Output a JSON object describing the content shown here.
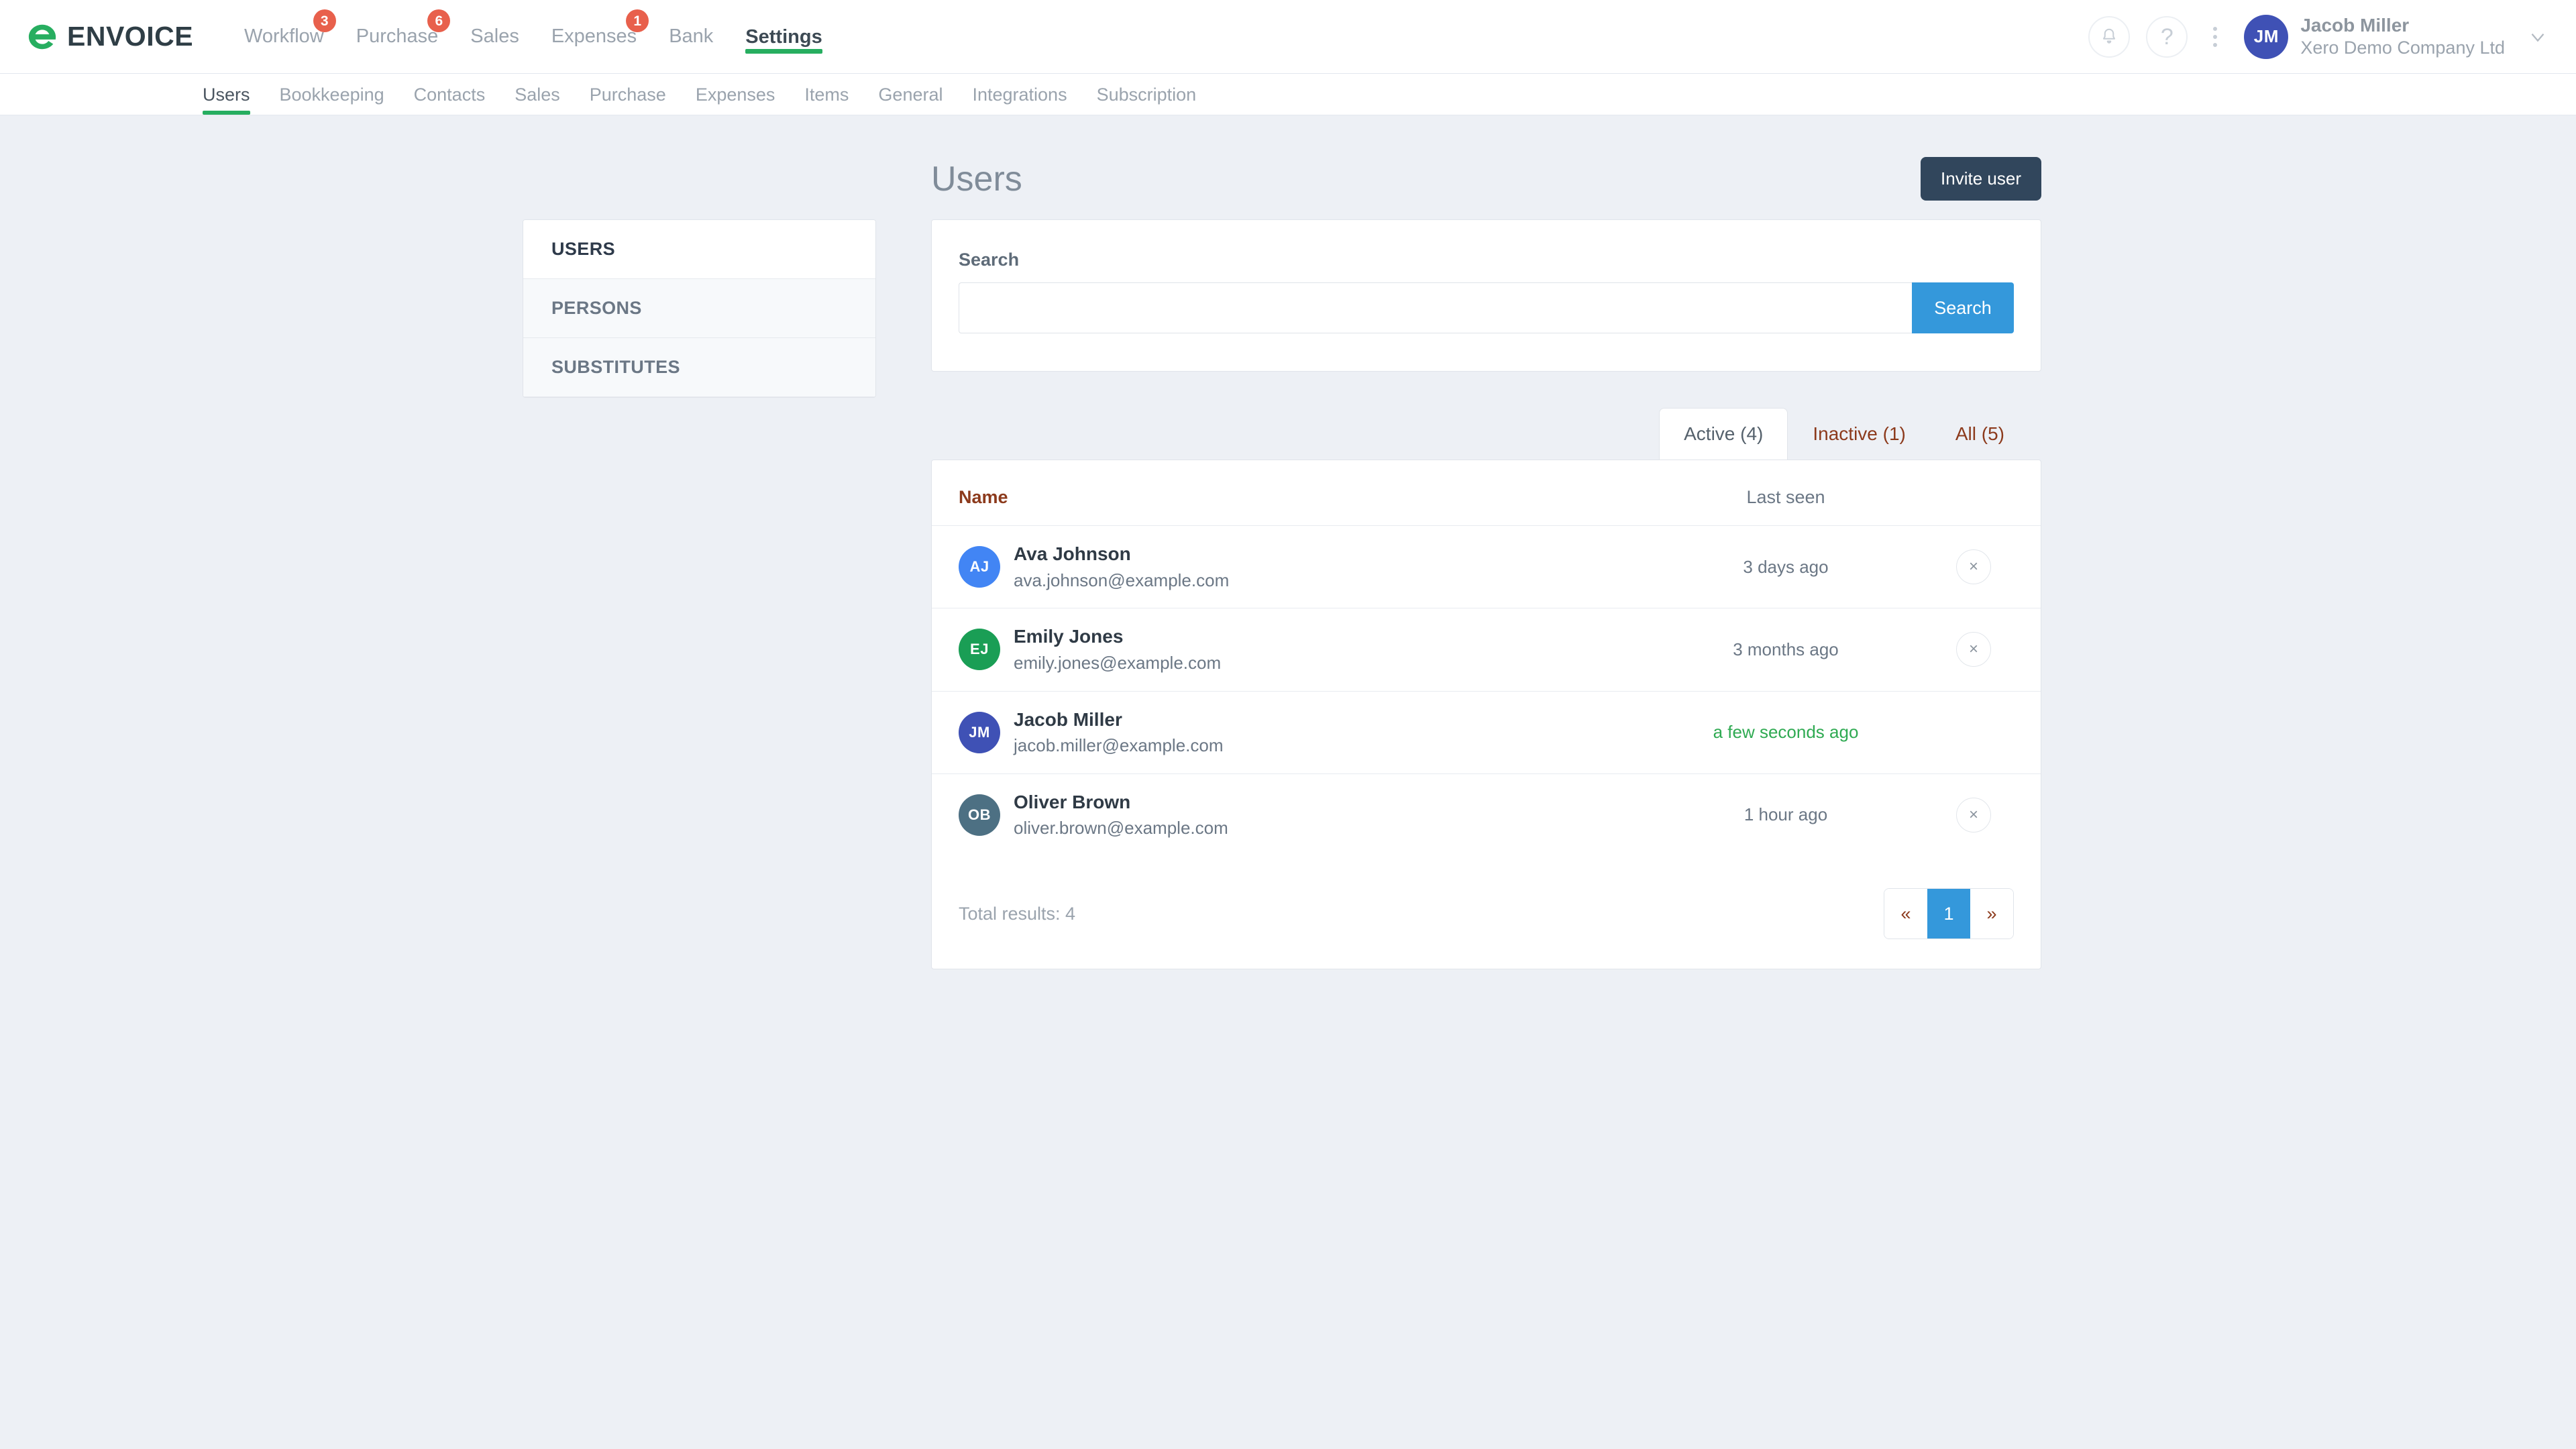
{
  "brand": {
    "name": "ENVOICE",
    "mark_color": "#27ae60",
    "text_color": "#2f3e46"
  },
  "topnav": {
    "items": [
      {
        "label": "Workflow",
        "badge": "3",
        "active": false
      },
      {
        "label": "Purchase",
        "badge": "6",
        "active": false
      },
      {
        "label": "Sales",
        "badge": "",
        "active": false
      },
      {
        "label": "Expenses",
        "badge": "1",
        "active": false
      },
      {
        "label": "Bank",
        "badge": "",
        "active": false
      },
      {
        "label": "Settings",
        "badge": "",
        "active": true
      }
    ],
    "badge_color": "#e8604c",
    "active_underline_color": "#27ae60"
  },
  "account": {
    "notifications_icon": "bell-icon",
    "help_icon": "question-mark-icon",
    "more_icon": "kebab-menu-icon",
    "avatar_initials": "JM",
    "avatar_color": "#3f51b5",
    "name": "Jacob Miller",
    "organization": "Xero Demo Company Ltd",
    "chevron_icon": "chevron-down-icon"
  },
  "subnav": {
    "items": [
      {
        "label": "Users",
        "active": true
      },
      {
        "label": "Bookkeeping",
        "active": false
      },
      {
        "label": "Contacts",
        "active": false
      },
      {
        "label": "Sales",
        "active": false
      },
      {
        "label": "Purchase",
        "active": false
      },
      {
        "label": "Expenses",
        "active": false
      },
      {
        "label": "Items",
        "active": false
      },
      {
        "label": "General",
        "active": false
      },
      {
        "label": "Integrations",
        "active": false
      },
      {
        "label": "Subscription",
        "active": false
      }
    ]
  },
  "page": {
    "title": "Users",
    "invite_button": "Invite user"
  },
  "sidemenu": {
    "items": [
      {
        "label": "USERS",
        "active": true
      },
      {
        "label": "PERSONS",
        "active": false
      },
      {
        "label": "SUBSTITUTES",
        "active": false
      }
    ]
  },
  "search": {
    "label": "Search",
    "value": "",
    "placeholder": "",
    "button": "Search",
    "button_color": "#3498db"
  },
  "tabs": [
    {
      "label": "Active (4)",
      "active": true
    },
    {
      "label": "Inactive (1)",
      "active": false
    },
    {
      "label": "All (5)",
      "active": false
    }
  ],
  "table": {
    "columns": {
      "name": "Name",
      "last_seen": "Last seen"
    },
    "rows": [
      {
        "initials": "AJ",
        "avatar_color": "#4285f4",
        "name": "Ava Johnson",
        "email": "ava.johnson@example.com",
        "last_seen": "3 days ago",
        "last_seen_fresh": false,
        "remove_label": "×",
        "removable": true
      },
      {
        "initials": "EJ",
        "avatar_color": "#1a9e55",
        "name": "Emily Jones",
        "email": "emily.jones@example.com",
        "last_seen": "3 months ago",
        "last_seen_fresh": false,
        "remove_label": "×",
        "removable": true
      },
      {
        "initials": "JM",
        "avatar_color": "#3f51b5",
        "name": "Jacob Miller",
        "email": "jacob.miller@example.com",
        "last_seen": "a few seconds ago",
        "last_seen_fresh": true,
        "remove_label": "",
        "removable": false
      },
      {
        "initials": "OB",
        "avatar_color": "#4d7083",
        "name": "Oliver Brown",
        "email": "oliver.brown@example.com",
        "last_seen": "1 hour ago",
        "last_seen_fresh": false,
        "remove_label": "×",
        "removable": true
      }
    ],
    "total_results": "Total results: 4"
  },
  "pagination": {
    "first_label": "«",
    "pages": [
      "1"
    ],
    "current_page": "1",
    "last_label": "»",
    "current_color": "#3498db"
  }
}
